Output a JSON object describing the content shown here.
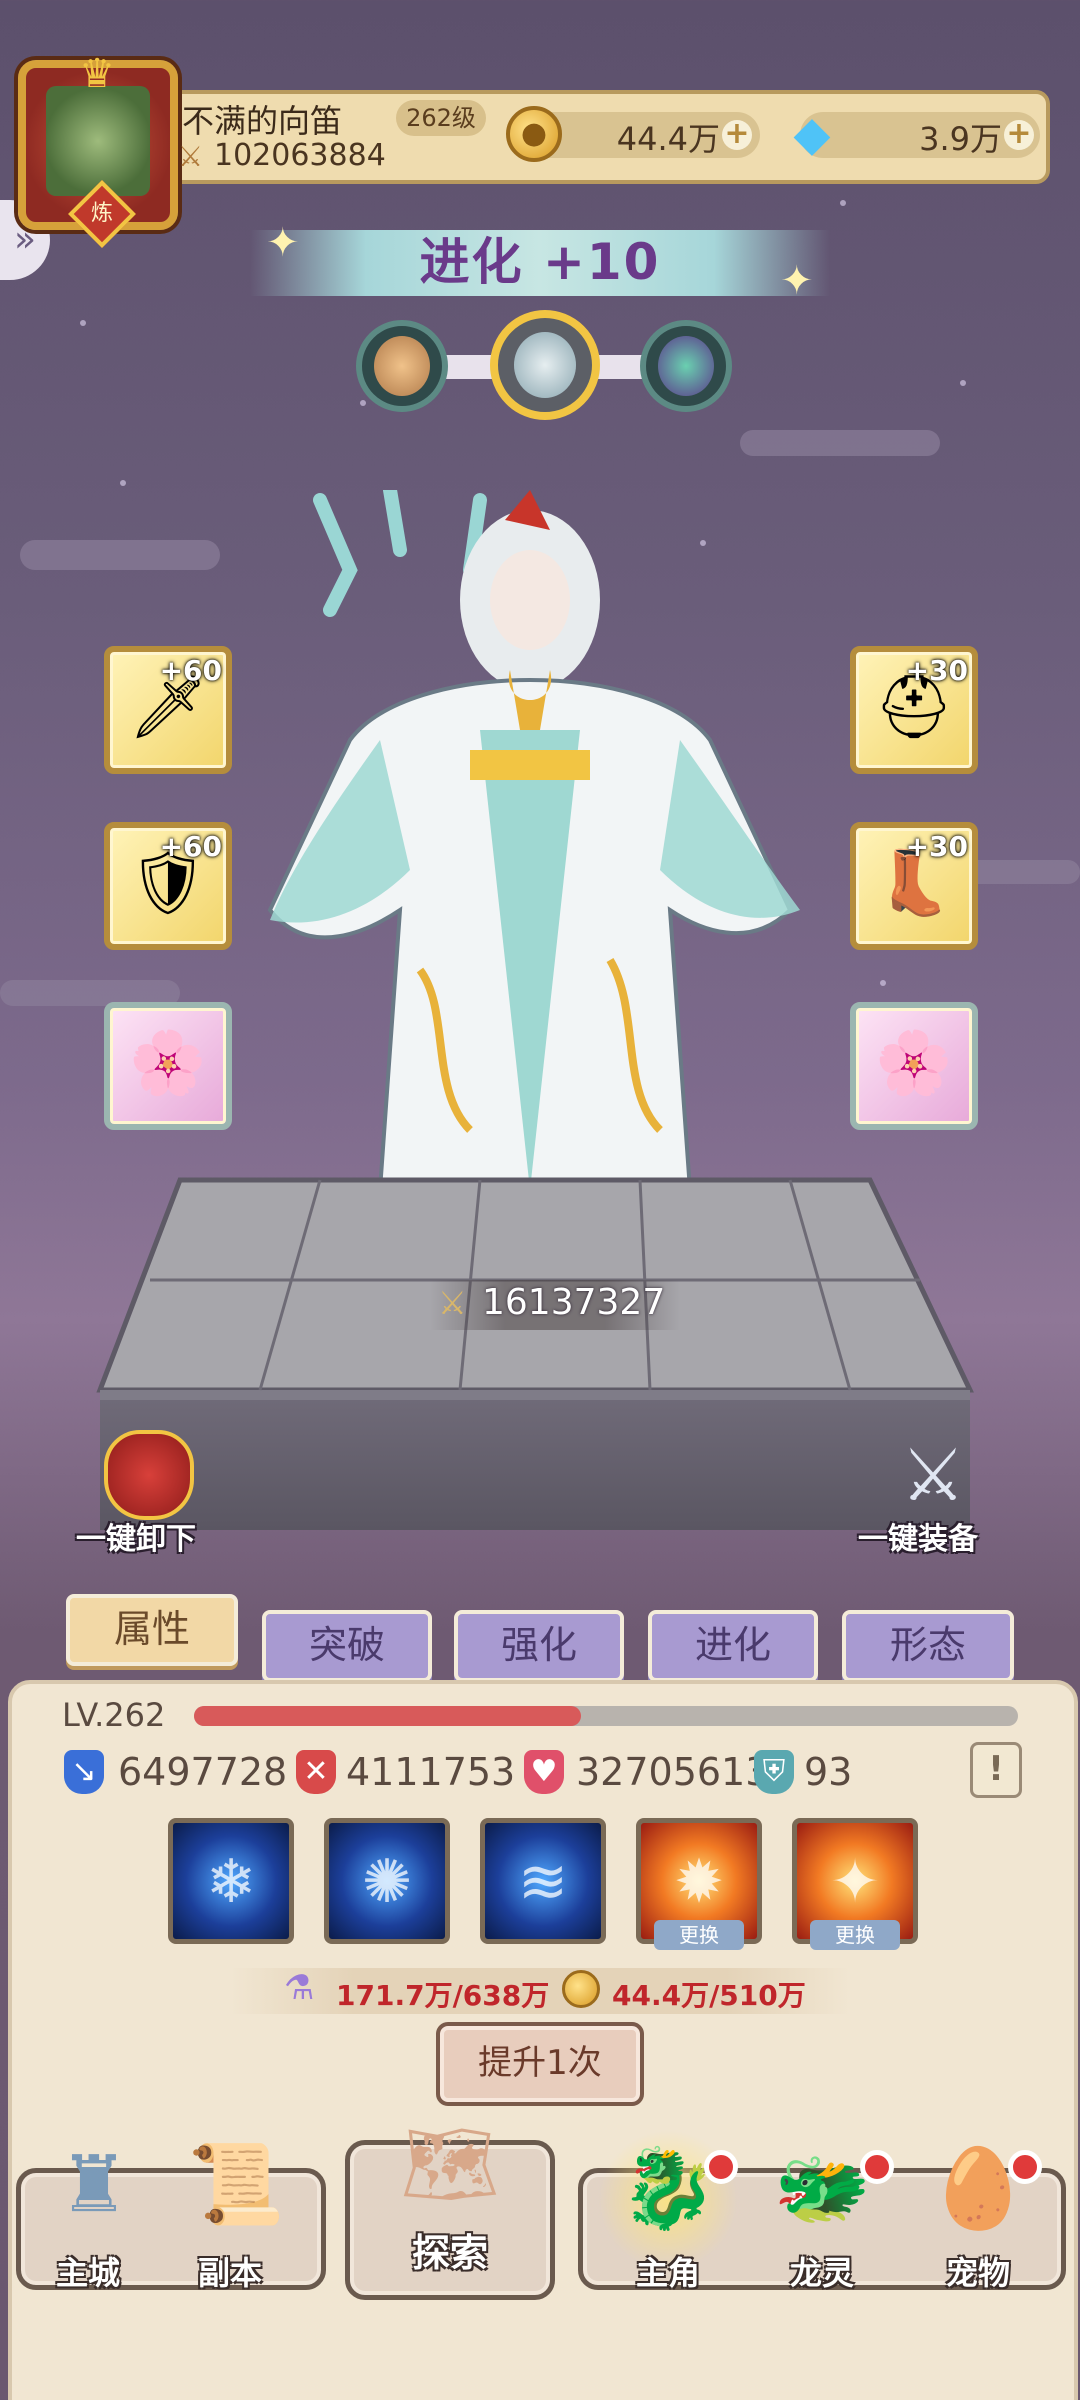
{
  "player": {
    "name": "不满的向笛",
    "level_badge": "262级",
    "power": "102063884",
    "refine_badge": "炼"
  },
  "currencies": {
    "gold": "44.4万",
    "diamond": "3.9万"
  },
  "evolution": {
    "title": "进化 +10"
  },
  "equipment": {
    "left": [
      {
        "name": "sword",
        "plus": "+60",
        "glyph": "🗡"
      },
      {
        "name": "armor",
        "plus": "+60",
        "glyph": "🛡"
      },
      {
        "name": "wing-gem",
        "plus": "",
        "glyph": "🌸"
      }
    ],
    "right": [
      {
        "name": "helmet",
        "plus": "+30",
        "glyph": "⛑"
      },
      {
        "name": "boots",
        "plus": "+30",
        "glyph": "👢"
      },
      {
        "name": "wing-gem",
        "plus": "",
        "glyph": "🌸"
      }
    ]
  },
  "character": {
    "combat_power": "16137327"
  },
  "quick_actions": {
    "unequip_all": "一键卸下",
    "equip_all": "一键装备"
  },
  "tabs": [
    "属性",
    "突破",
    "强化",
    "进化",
    "形态"
  ],
  "stats": {
    "level_label": "LV.262",
    "xp_fraction": 0.47,
    "attack": "6497728",
    "defense": "4111753",
    "hp": "32705613",
    "extra": "93",
    "info_symbol": "!"
  },
  "skills": [
    {
      "type": "ice",
      "swap": ""
    },
    {
      "type": "ice",
      "swap": ""
    },
    {
      "type": "ice",
      "swap": ""
    },
    {
      "type": "fire",
      "swap": "更换"
    },
    {
      "type": "fire",
      "swap": "更换"
    }
  ],
  "cost": {
    "material": "171.7万/638万",
    "gold": "44.4万/510万"
  },
  "upgrade_button": "提升1次",
  "nav": {
    "city": "主城",
    "dungeon": "副本",
    "explore": "探索",
    "hero": "主角",
    "dragon": "龙灵",
    "pet": "宠物"
  },
  "colors": {
    "accent_gold": "#f2c543",
    "tab_purple": "#a89ad1",
    "cost_red": "#c0262b"
  }
}
